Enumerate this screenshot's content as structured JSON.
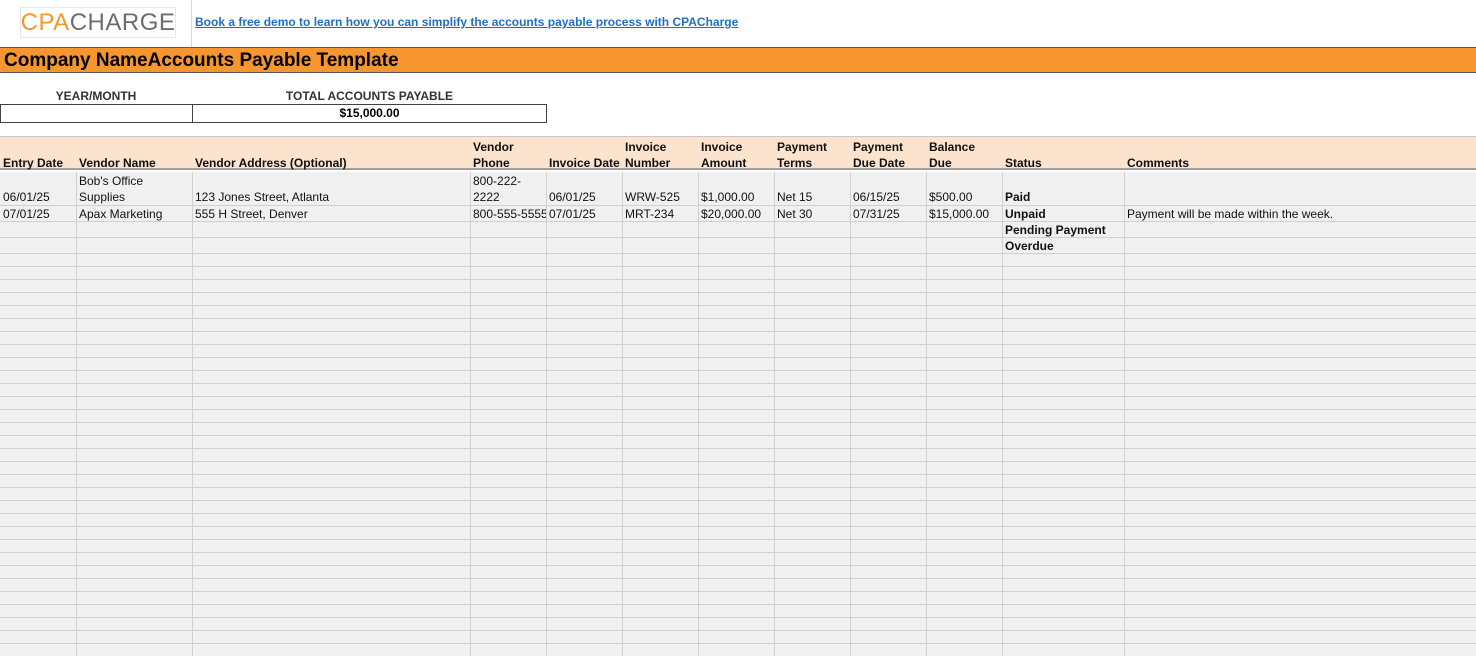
{
  "brand": {
    "logo_part1": "CPA",
    "logo_part2": "CHARGE",
    "color_accent": "#f7962e",
    "demo_link": "Book a free demo to learn how you can simplify the accounts payable process with CPACharge"
  },
  "title": "Company NameAccounts Payable Template",
  "summary": {
    "year_month_label": "YEAR/MONTH",
    "year_month_value": "",
    "total_label": "TOTAL ACCOUNTS PAYABLE",
    "total_value": "$15,000.00"
  },
  "table": {
    "headers": {
      "entry_date": "Entry Date",
      "vendor_name": "Vendor Name",
      "vendor_address": "Vendor Address (Optional)",
      "vendor_phone_1": "Vendor",
      "vendor_phone_2": "Phone",
      "invoice_date": "Invoice Date",
      "invoice_number_1": "Invoice",
      "invoice_number_2": "Number",
      "invoice_amount_1": "Invoice",
      "invoice_amount_2": "Amount",
      "payment_terms_1": "Payment",
      "payment_terms_2": "Terms",
      "payment_due_1": "Payment",
      "payment_due_2": "Due Date",
      "balance_due_1": "Balance",
      "balance_due_2": "Due",
      "status": "Status",
      "comments": "Comments"
    },
    "rows": [
      {
        "entry_date": "06/01/25",
        "vendor_name_1": "Bob's Office",
        "vendor_name_2": "Supplies",
        "vendor_address": "123 Jones Street, Atlanta",
        "vendor_phone_1": "800-222-",
        "vendor_phone_2": "2222",
        "invoice_date": "06/01/25",
        "invoice_number": "WRW-525",
        "invoice_amount": "$1,000.00",
        "payment_terms": "Net 15",
        "payment_due": "06/15/25",
        "balance_due": "$500.00",
        "status": "Paid",
        "comments": ""
      },
      {
        "entry_date": "07/01/25",
        "vendor_name": "Apax Marketing",
        "vendor_address": "555 H Street, Denver",
        "vendor_phone": "800-555-5555",
        "invoice_date": "07/01/25",
        "invoice_number": "MRT-234",
        "invoice_amount": "$20,000.00",
        "payment_terms": "Net 30",
        "payment_due": "07/31/25",
        "balance_due": "$15,000.00",
        "status": "Unpaid",
        "comments": "Payment will be made within the week."
      }
    ],
    "status_options": [
      "Pending Payment",
      "Overdue"
    ]
  }
}
